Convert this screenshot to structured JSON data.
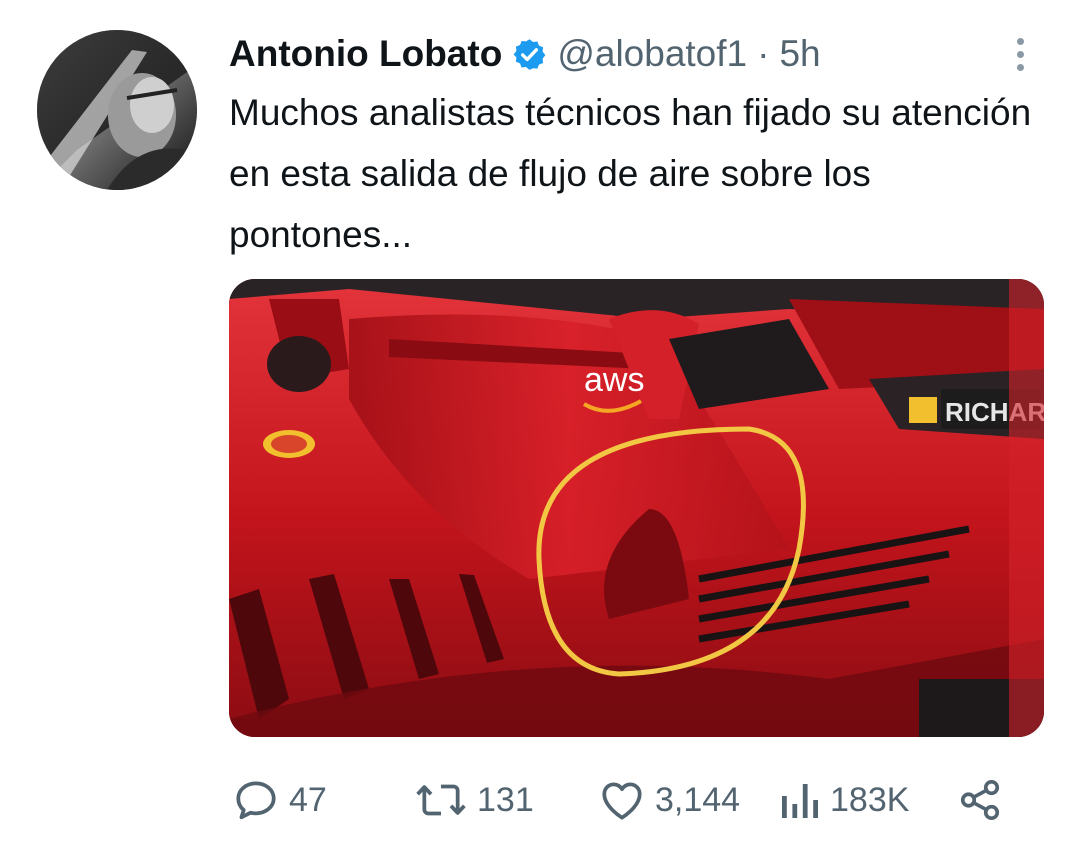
{
  "tweet": {
    "author_name": "Antonio Lobato",
    "handle": "@alobatof1",
    "separator": "·",
    "time": "5h",
    "text": "Muchos analistas técnicos han fijado su atención en esta salida de flujo de aire sobre los pontones...",
    "media": {
      "description_icon": "ferrari-f1-car-photo",
      "labels": {
        "aws": "aws",
        "richard": "RICHARD"
      }
    },
    "actions": {
      "replies": "47",
      "retweets": "131",
      "likes": "3,144",
      "views": "183K"
    }
  },
  "colors": {
    "text_primary": "#0f1419",
    "text_secondary": "#536471",
    "verified_blue": "#1d9bf0",
    "car_red": "#c4141c",
    "highlight_circle": "#f2c744"
  }
}
